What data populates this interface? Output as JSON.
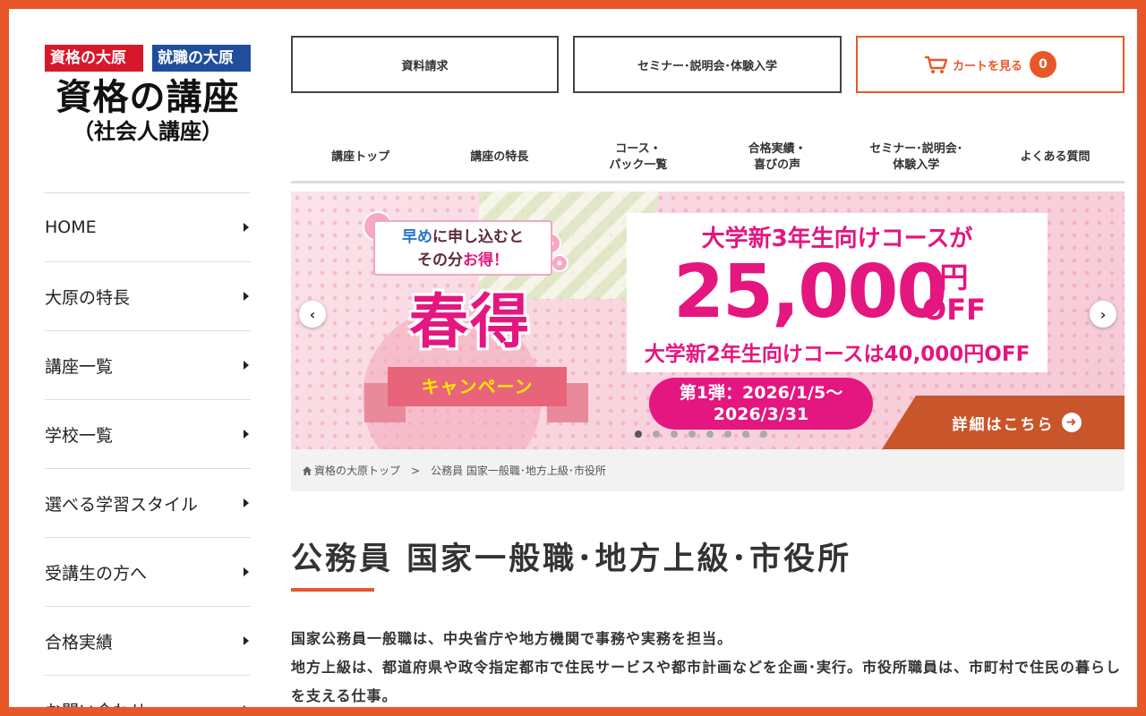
{
  "logo": {
    "badge1": "資格の大原",
    "badge2": "就職の大原",
    "main": "資格の講座",
    "sub": "（社会人講座）"
  },
  "sidebar": {
    "items": [
      {
        "label": "HOME"
      },
      {
        "label": "大原の特長"
      },
      {
        "label": "講座一覧"
      },
      {
        "label": "学校一覧"
      },
      {
        "label": "選べる学習スタイル"
      },
      {
        "label": "受講生の方へ"
      },
      {
        "label": "合格実績"
      },
      {
        "label": "お問い合わせ"
      }
    ]
  },
  "header": {
    "request_docs": "資料請求",
    "seminar": "セミナー･説明会･体験入学",
    "cart_label": "カートを見る",
    "cart_count": "0"
  },
  "gnav": {
    "items": [
      {
        "label": "講座トップ"
      },
      {
        "label": "講座の特長"
      },
      {
        "label": "コース・\nパック一覧"
      },
      {
        "label": "合格実績・\n喜びの声"
      },
      {
        "label": "セミナー･説明会･\n体験入学"
      },
      {
        "label": "よくある質問"
      }
    ]
  },
  "banner": {
    "early_line1_a": "早め",
    "early_line1_b": "に申し込むと",
    "early_line2_a": "その分",
    "early_line2_b": "お得！",
    "haru": "春得",
    "campaign": "キャンペーン",
    "offer_line1": "大学新3年生向けコースが",
    "offer_amount": "25,000",
    "offer_unit_yen": "円",
    "offer_unit_off": "OFF",
    "offer_line3": "大学新2年生向けコースは40,000円OFF",
    "date_line1": "第1弾：2026/1/5～",
    "date_line2": "2026/3/31",
    "detail": "詳細はこちら",
    "slide_count": 8,
    "active_slide": 0,
    "accent_pink": "#e4167f",
    "accent_orange": "#c9552b"
  },
  "breadcrumb": {
    "home": "資格の大原トップ",
    "separator": ">",
    "current": "公務員 国家一般職･地方上級･市役所"
  },
  "main": {
    "title": "公務員 国家一般職･地方上級･市役所",
    "intro_line1": "国家公務員一般職は、中央省庁や地方機関で事務や実務を担当。",
    "intro_line2": "地方上級は、都道府県や政令指定都市で住民サービスや都市計画などを企画･実行。市役所職員は、市町村で住民の暮らしを支える仕事。"
  },
  "colors": {
    "brand_orange": "#e8572a",
    "badge_red": "#d7182a",
    "badge_blue": "#1f4f9c"
  }
}
